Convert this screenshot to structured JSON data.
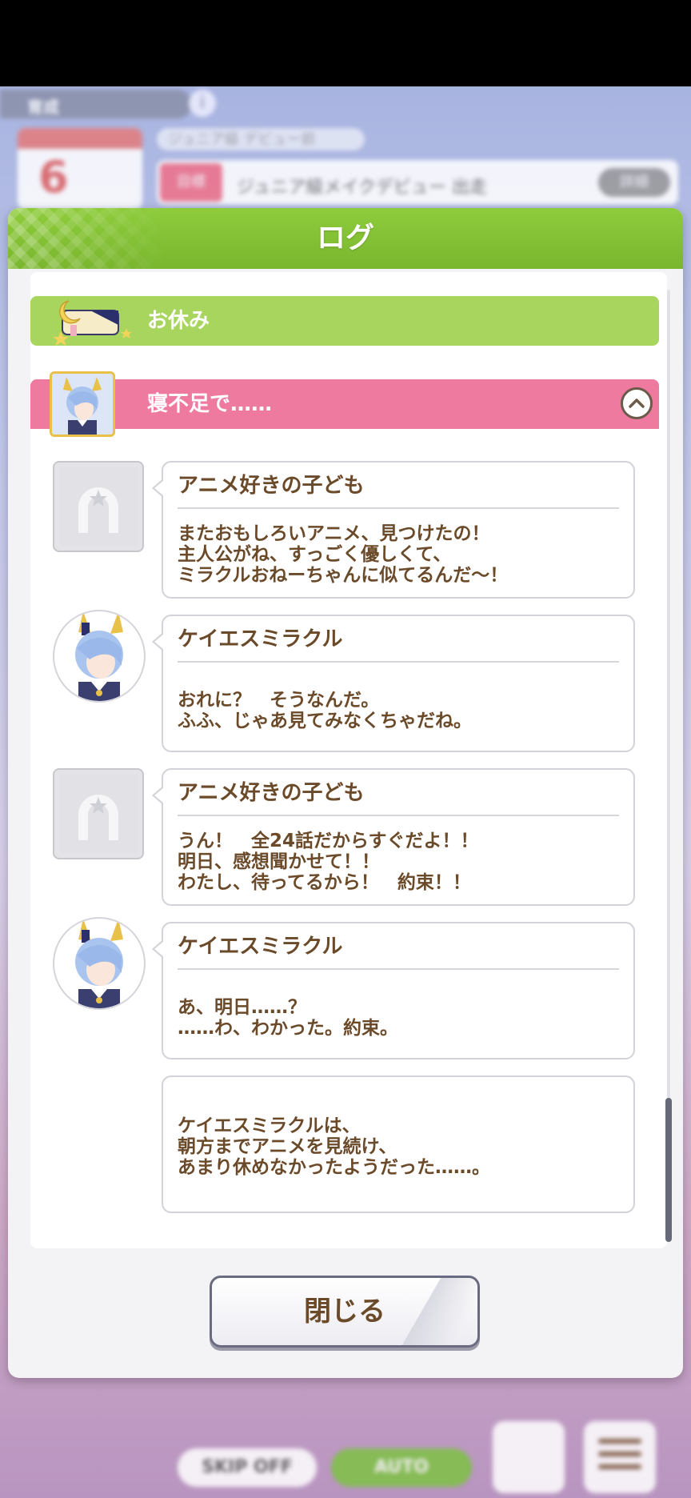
{
  "background": {
    "top_label": "育成",
    "info_icon": "info-icon",
    "calendar_day": "6",
    "goal_label": "ジュニア級 デビュー前",
    "target_tag": "目標",
    "target_text": "ジュニア級メイクデビュー 出走",
    "target_button": "詳細",
    "skip_label": "SKIP OFF",
    "auto_label": "AUTO"
  },
  "dialog": {
    "title": "ログ",
    "close_label": "閉じる"
  },
  "sections": {
    "rest_label": "お休み",
    "event_label": "寝不足で……"
  },
  "log": [
    {
      "speaker": "アニメ好きの子ども",
      "text": "またおもしろいアニメ、見つけたの！\n主人公がね、すっごく優しくて、\nミラクルおねーちゃんに似てるんだ～！",
      "avatar": "horseshoe-placeholder-icon"
    },
    {
      "speaker": "ケイエスミラクル",
      "text": "おれに？　そうなんだ。\nふふ、じゃあ見てみなくちゃだね。",
      "avatar": "character-avatar"
    },
    {
      "speaker": "アニメ好きの子ども",
      "text": "うん！　全24話だからすぐだよ！！\n明日、感想聞かせて！！\nわたし、待ってるから！　約束！！",
      "avatar": "horseshoe-placeholder-icon"
    },
    {
      "speaker": "ケイエスミラクル",
      "text": "あ、明日……？\n……わ、わかった。約束。",
      "avatar": "character-avatar"
    },
    {
      "speaker": "",
      "text": "ケイエスミラクルは、\n朝方までアニメを見続け、\nあまり休めなかったようだった……。",
      "avatar": ""
    }
  ],
  "colors": {
    "header_green": "#7ab62e",
    "rest_green": "#a8d55e",
    "event_pink": "#ee7aa0",
    "text_brown": "#6b4a2a"
  }
}
